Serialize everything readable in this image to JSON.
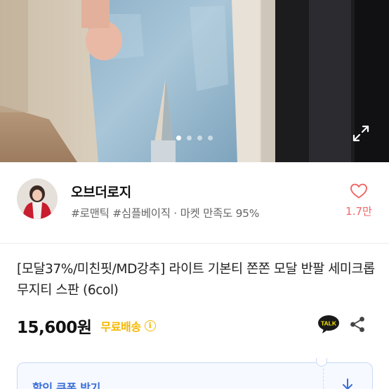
{
  "photo": {
    "alt": "jeans product photo",
    "slide_count": 4,
    "active_slide": 1,
    "expand_icon": "expand-icon"
  },
  "shop": {
    "name": "오브더로지",
    "tags_and_satisfaction": "#로맨틱 #심플베이직 · 마켓 만족도 95%",
    "like_icon": "heart-outline-icon",
    "like_count": "1.7만"
  },
  "product": {
    "title": "[모달37%/미친핏/MD강추] 라이트 기본티 쫀쫀 모달 반팔 세미크롭 무지티 스판 (6col)",
    "price": "15,600원",
    "shipping": "무료배송",
    "shipping_info_icon": "info-icon",
    "talk_label": "TALK",
    "share_icon": "share-icon"
  },
  "coupon": {
    "label": "할인 쿠폰 받기",
    "download_icon": "download-icon"
  },
  "colors": {
    "shipping": "#f5b800",
    "like": "#ef6666",
    "coupon_text": "#3a6fd8",
    "coupon_border": "#c8d9f6"
  }
}
